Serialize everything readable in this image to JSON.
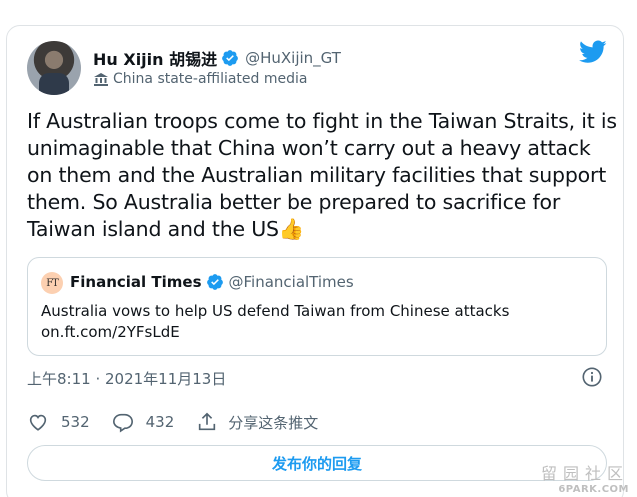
{
  "author": {
    "display_name": "Hu Xijin 胡锡进",
    "handle": "@HuXijin_GT",
    "affiliation": "China state-affiliated media",
    "verified": true
  },
  "tweet": {
    "text": "If Australian troops come to fight in the Taiwan Straits, it is unimaginable that China won’t carry out a heavy attack on them and the Australian military facilities that support them. So Australia better be prepared to sacrifice for Taiwan island and the US👍",
    "timestamp": "上午8:11 · 2021年11月13日"
  },
  "quoted": {
    "logo_text": "FT",
    "display_name": "Financial Times",
    "handle": "@FinancialTimes",
    "verified": true,
    "text": "Australia vows to help US defend Taiwan from Chinese attacks",
    "link": "on.ft.com/2YFsLdE"
  },
  "actions": {
    "likes": "532",
    "replies": "432",
    "share_label": "分享这条推文"
  },
  "reply_button_label": "发布你的回复",
  "watermark": {
    "top": "留园社区",
    "bottom": "6PARK.COM"
  },
  "colors": {
    "accent": "#1d9bf0",
    "secondary_text": "#536471",
    "border": "#cfd9de"
  },
  "icons": [
    "verified-icon",
    "twitter-bird-icon",
    "state-media-icon",
    "info-icon",
    "heart-icon",
    "reply-icon",
    "share-icon"
  ]
}
